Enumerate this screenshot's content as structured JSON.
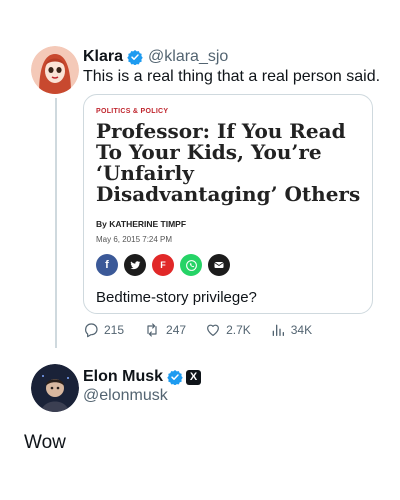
{
  "tweet1": {
    "author_name": "Klara",
    "author_handle": "@klara_sjo",
    "text": "This is a real thing that a real person said.",
    "card": {
      "category": "POLITICS & POLICY",
      "headline": "Professor: If You Read To Your Kids, You’re ‘Unfairly Disadvantaging’ Others",
      "byline": "By KATHERINE TIMPF",
      "date": "May 6, 2015 7:24 PM",
      "share_icons": [
        {
          "name": "facebook-icon",
          "glyph": "f",
          "color": "#3b5998"
        },
        {
          "name": "twitter-icon",
          "glyph": "🐦",
          "color": "#1c1c1c"
        },
        {
          "name": "flipboard-icon",
          "glyph": "F",
          "color": "#e12828"
        },
        {
          "name": "whatsapp-icon",
          "glyph": "✆",
          "color": "#25d366"
        },
        {
          "name": "email-icon",
          "glyph": "✉",
          "color": "#1c1c1c"
        }
      ],
      "caption": "Bedtime-story privilege?"
    },
    "actions": {
      "replies": "215",
      "reposts": "247",
      "likes": "2.7K",
      "views": "34K"
    }
  },
  "tweet2": {
    "author_name": "Elon Musk",
    "author_handle": "@elonmusk",
    "text": "Wow"
  },
  "colors": {
    "verified_blue": "#1d9bf0",
    "muted_text": "#536471",
    "thread_line": "#cfd9de",
    "category_red": "#c0262e"
  }
}
